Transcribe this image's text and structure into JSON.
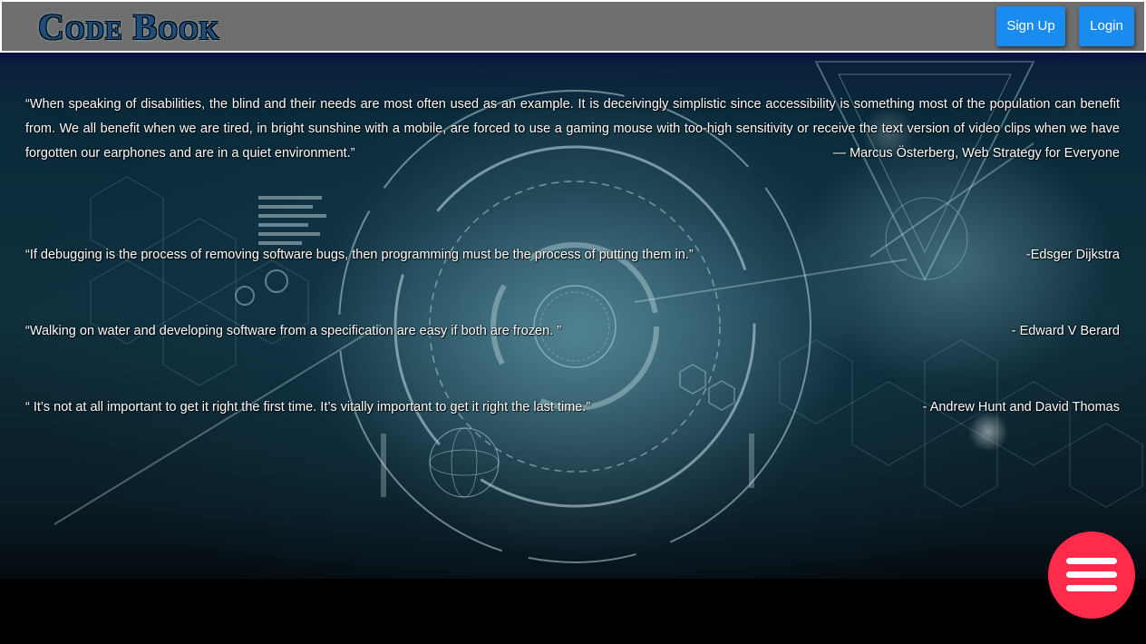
{
  "header": {
    "logo_text": "Code Book",
    "signup_label": "Sign Up",
    "login_label": "Login"
  },
  "quotes": [
    {
      "text": "“When speaking of disabilities, the blind and their needs are most often used as an example. It is deceivingly simplistic since accessibility is something most of the population can benefit from. We all benefit when we are tired, in bright sunshine with a mobile, are forced to use a gaming mouse with too-high sensitivity or receive the text version of video clips when we have forgotten our earphones and are in a quiet environment.”",
      "author": "— Marcus Österberg, Web Strategy for Everyone"
    },
    {
      "text": "“If debugging is the process of removing software bugs, then programming must be the process of putting them in.”",
      "author": "-Edsger Dijkstra"
    },
    {
      "text": "“Walking on water and developing software from a specification are easy if both are frozen. ”",
      "author": "- Edward V Berard"
    },
    {
      "text": "“ It’s not at all important to get it right the first time. It’s vitally important to get it right the last time.”",
      "author": "- Andrew Hunt and David Thomas"
    }
  ],
  "fab": {
    "icon": "hamburger-menu-icon"
  },
  "colors": {
    "header_bg": "#6e6e6e",
    "button_bg": "#1a8cf0",
    "fab_bg": "#ff2b4a",
    "text": "#ffffff"
  }
}
